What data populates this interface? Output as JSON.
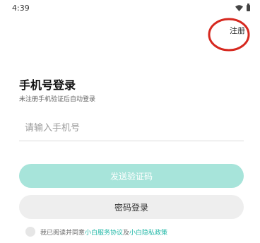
{
  "status_bar": {
    "time": "4:39",
    "icons": [
      "wifi-icon",
      "battery-icon"
    ]
  },
  "header": {
    "register_label": "注册"
  },
  "annotation": {
    "shape": "red-circle",
    "color": "#d6281f",
    "target": "register-link"
  },
  "login": {
    "title": "手机号登录",
    "subtitle": "未注册手机验证后自动登录",
    "phone_placeholder": "请输入手机号",
    "phone_value": "",
    "send_code_label": "发送验证码",
    "password_login_label": "密码登录"
  },
  "agreement": {
    "prefix": "我已阅读并同意",
    "service_link": "小白服务协议",
    "conjunction": "及",
    "privacy_link": "小白隐私政策",
    "checked": false
  },
  "colors": {
    "accent": "#1fb7a6",
    "send_button_bg": "#a7e4da",
    "password_button_bg": "#eeeeee"
  }
}
